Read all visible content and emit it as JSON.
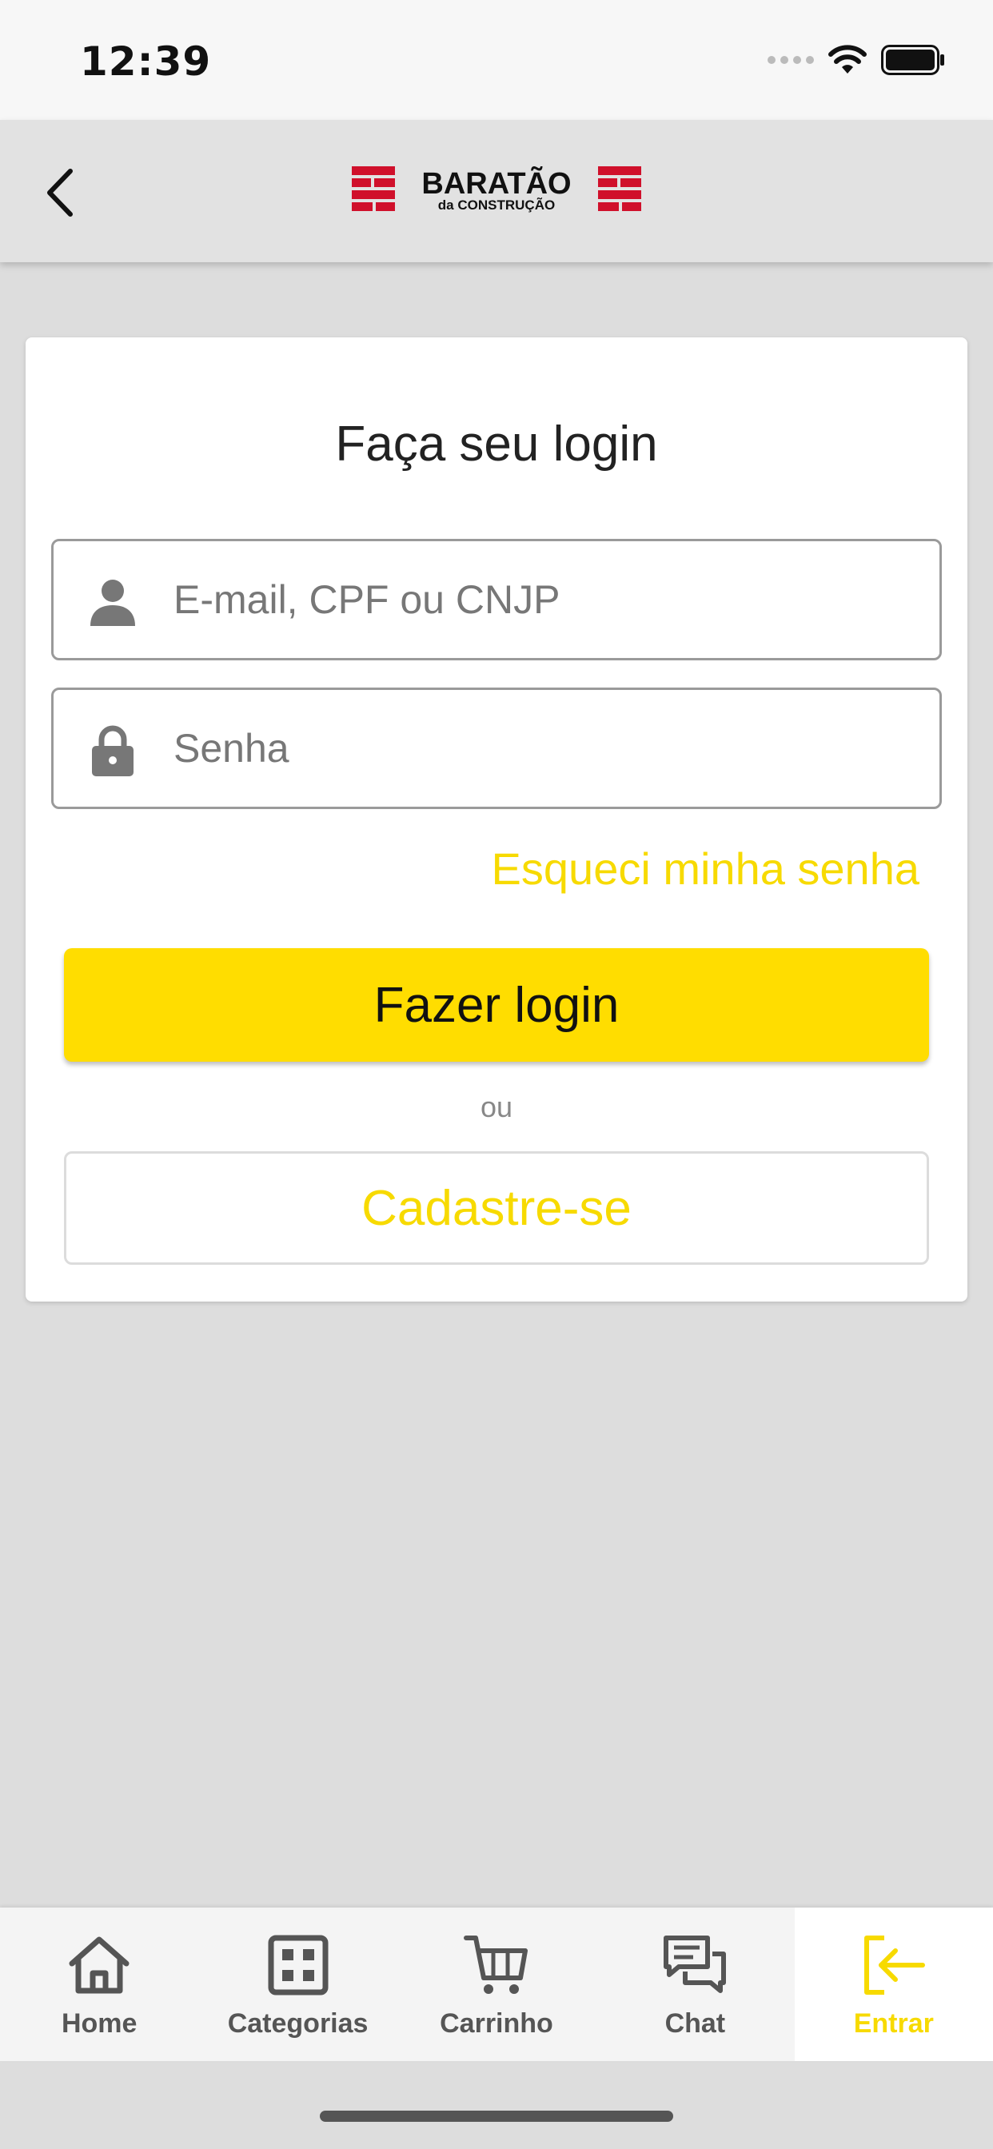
{
  "status_bar": {
    "time": "12:39"
  },
  "header": {
    "logo_text": "BARATÃO",
    "logo_subtext": "da CONSTRUÇÃO"
  },
  "login": {
    "title": "Faça seu login",
    "email_placeholder": "E-mail, CPF ou CNJP",
    "password_placeholder": "Senha",
    "forgot_label": "Esqueci minha senha",
    "login_label": "Fazer login",
    "or_label": "ou",
    "signup_label": "Cadastre-se"
  },
  "bottom_nav": {
    "items": [
      {
        "label": "Home",
        "icon": "home-icon"
      },
      {
        "label": "Categorias",
        "icon": "grid-icon"
      },
      {
        "label": "Carrinho",
        "icon": "cart-icon"
      },
      {
        "label": "Chat",
        "icon": "chat-icon"
      },
      {
        "label": "Entrar",
        "icon": "login-icon",
        "active": true
      }
    ]
  },
  "colors": {
    "accent": "#FFDD00",
    "brand_red": "#D0102B",
    "background": "#DDDDDD"
  }
}
